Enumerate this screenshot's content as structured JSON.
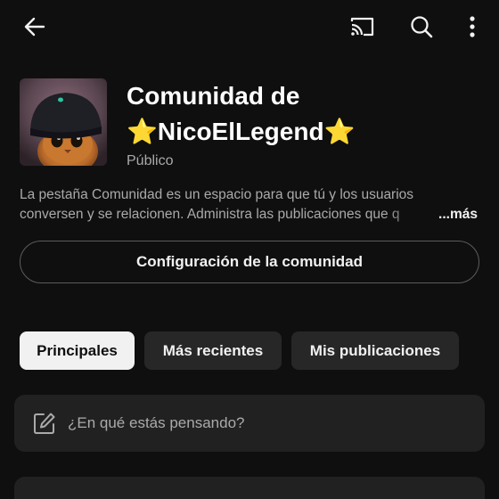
{
  "icons": {
    "back": "arrow-left-icon",
    "cast": "cast-icon",
    "search": "search-icon",
    "more": "more-vertical-icon",
    "compose": "pencil-icon"
  },
  "community": {
    "title_prefix": "Comunidad de",
    "star": "⭐",
    "name": "NicoElLegend",
    "visibility": "Público"
  },
  "description": {
    "line1": "La pestaña Comunidad es un espacio para que tú y los usuarios",
    "line2": "conversen y se relacionen. Administra las publicaciones que q",
    "more_label": "...más"
  },
  "config_button": "Configuración de la comunidad",
  "tabs": [
    {
      "label": "Principales",
      "active": true
    },
    {
      "label": "Más recientes",
      "active": false
    },
    {
      "label": "Mis publicaciones",
      "active": false
    }
  ],
  "composer": {
    "placeholder": "¿En qué estás pensando?"
  },
  "colors": {
    "background": "#0f0f0f",
    "surface": "#212121",
    "chip": "#272727",
    "text_primary": "#f1f1f1",
    "text_secondary": "#aaaaaa",
    "star": "#fcc21b"
  }
}
